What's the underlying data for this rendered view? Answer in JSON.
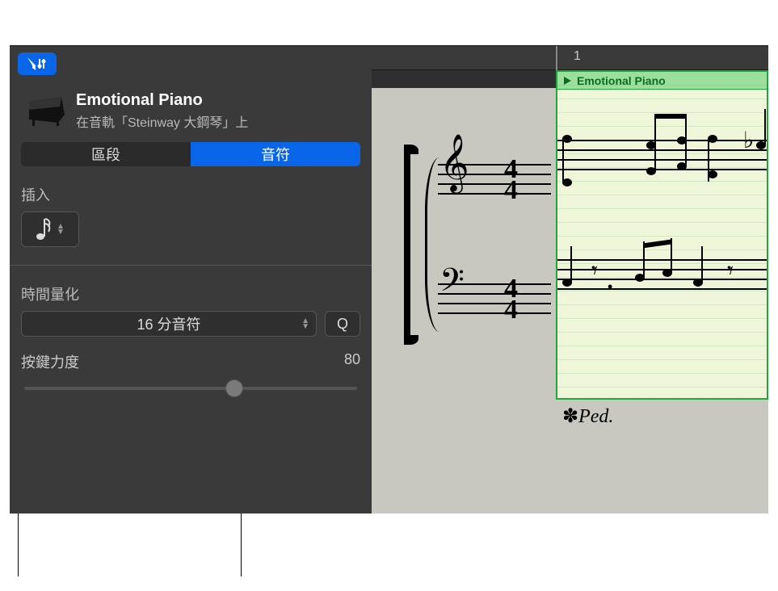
{
  "inspector": {
    "track_title": "Emotional Piano",
    "track_subtitle": "在音軌「Steinway 大鋼琴」上",
    "tabs": {
      "region": "區段",
      "notes": "音符"
    },
    "insert_label": "插入",
    "quantize_label": "時間量化",
    "quantize_value": "16 分音符",
    "q_button": "Q",
    "velocity_label": "按鍵力度",
    "velocity_value": "80",
    "velocity_percent": 63
  },
  "score": {
    "ruler_marker": "1",
    "region_name": "Emotional Piano",
    "pedal_mark": "✽𝆯ed.",
    "time_signature": {
      "top": "4",
      "bottom": "4"
    }
  },
  "icons": {
    "filter": "filter-icon",
    "piano": "piano-icon",
    "note": "sixteenth-note-icon",
    "play": "play-icon"
  }
}
